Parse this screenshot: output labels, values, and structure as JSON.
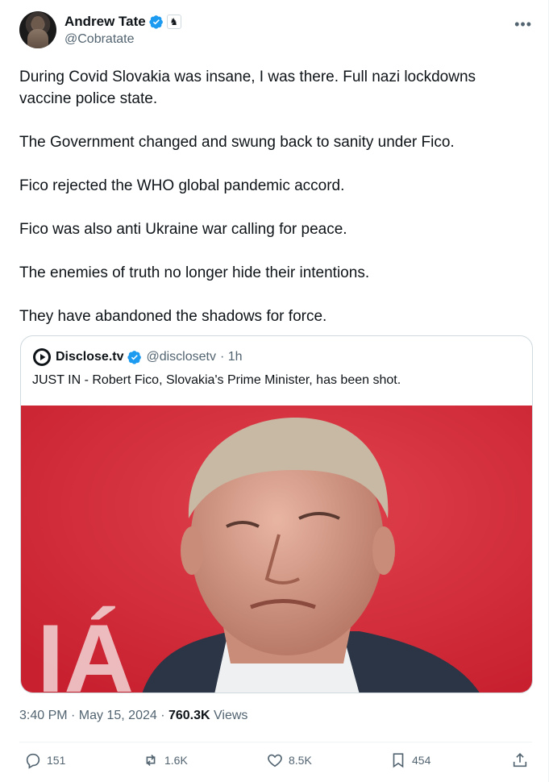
{
  "author": {
    "name": "Andrew Tate",
    "handle": "@Cobratate"
  },
  "tweet": {
    "paragraphs": [
      "During Covid Slovakia was insane, I was there. Full nazi lockdowns vaccine police state.",
      "The Government changed and swung back to sanity under Fico.",
      "Fico rejected the WHO global pandemic accord.",
      "Fico was also anti Ukraine war calling for peace.",
      "The enemies of truth no longer hide their intentions.",
      "They have abandoned the shadows for force."
    ]
  },
  "quote": {
    "name": "Disclose.tv",
    "handle": "@disclosetv",
    "time": "· 1h",
    "text": "JUST IN - Robert Fico, Slovakia's Prime Minister, has been shot.",
    "image_text": "IÁ"
  },
  "meta": {
    "time": "3:40 PM · May 15, 2024 · ",
    "views_count": "760.3K",
    "views_label": " Views"
  },
  "actions": {
    "replies": "151",
    "reposts": "1.6K",
    "likes": "8.5K",
    "bookmarks": "454"
  },
  "colors": {
    "verified": "#1d9bf0",
    "secondary_text": "#536471",
    "image_bg": "#d8323f"
  }
}
